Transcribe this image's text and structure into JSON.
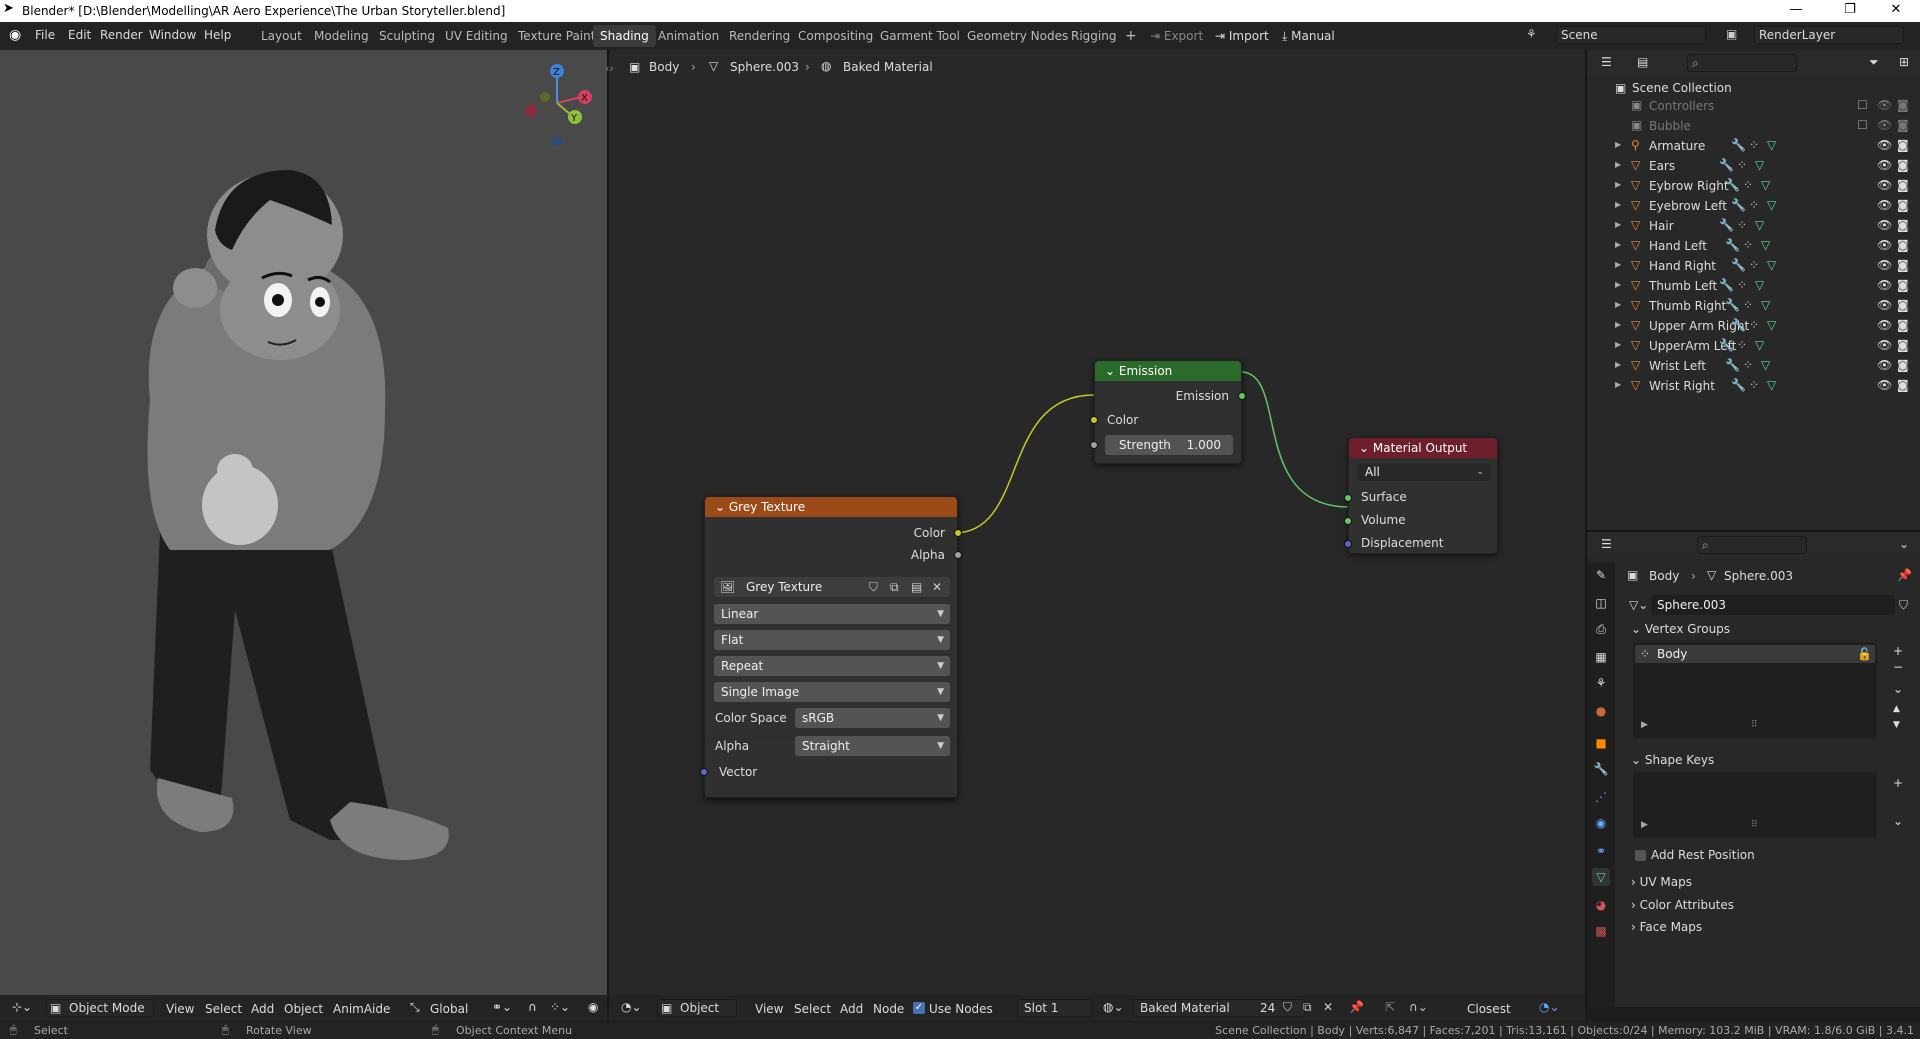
{
  "window": {
    "title": "Blender* [D:\\Blender\\Modelling\\AR Aero Experience\\The Urban Storyteller.blend]",
    "controls": [
      "—",
      "❐",
      "✕"
    ]
  },
  "menu": [
    "File",
    "Edit",
    "Render",
    "Window",
    "Help"
  ],
  "workspaces": [
    "Layout",
    "Modeling",
    "Sculpting",
    "UV Editing",
    "Texture Paint",
    "Shading",
    "Animation",
    "Rendering",
    "Compositing",
    "Garment Tool",
    "Geometry Nodes",
    "Rigging"
  ],
  "active_workspace": "Shading",
  "topbar": {
    "export": "Export",
    "import": "Import",
    "manual": "Manual",
    "scene": "Scene",
    "renderlayer": "RenderLayer"
  },
  "breadcrumb": {
    "object": "Body",
    "mesh": "Sphere.003",
    "material": "Baked Material"
  },
  "gizmo": {
    "x": "X",
    "y": "Y",
    "z": "Z"
  },
  "nodes": {
    "grey": {
      "title": "Grey Texture",
      "out_color": "Color",
      "out_alpha": "Alpha",
      "image_name": "Grey Texture",
      "interp": "Linear",
      "proj": "Flat",
      "ext": "Repeat",
      "source": "Single Image",
      "cs_label": "Color Space",
      "cs_value": "sRGB",
      "alpha_label": "Alpha",
      "alpha_value": "Straight",
      "vector": "Vector"
    },
    "emission": {
      "title": "Emission",
      "out": "Emission",
      "color": "Color",
      "strength_label": "Strength",
      "strength_value": "1.000"
    },
    "output": {
      "title": "Material Output",
      "target": "All",
      "surface": "Surface",
      "volume": "Volume",
      "displacement": "Displacement"
    }
  },
  "node_header": {
    "mode": "Object",
    "view": "View",
    "select": "Select",
    "add": "Add",
    "node": "Node",
    "use_nodes": "Use Nodes",
    "slot": "Slot 1",
    "material": "Baked Material",
    "users": "24",
    "closest": "Closest"
  },
  "viewport_header": {
    "mode": "Object Mode",
    "view": "View",
    "select": "Select",
    "add": "Add",
    "object": "Object",
    "animaide": "AnimAide",
    "orientation": "Global"
  },
  "outliner": {
    "root": "Scene Collection",
    "items": [
      {
        "name": "Controllers",
        "dim": true
      },
      {
        "name": "Bubble",
        "dim": true
      },
      {
        "name": "Armature"
      },
      {
        "name": "Ears"
      },
      {
        "name": "Eybrow Right"
      },
      {
        "name": "Eyebrow Left"
      },
      {
        "name": "Hair"
      },
      {
        "name": "Hand Left"
      },
      {
        "name": "Hand Right"
      },
      {
        "name": "Thumb Left"
      },
      {
        "name": "Thumb Right"
      },
      {
        "name": "Upper Arm Right"
      },
      {
        "name": "UpperArm Left"
      },
      {
        "name": "Wrist Left"
      },
      {
        "name": "Wrist Right"
      }
    ]
  },
  "properties": {
    "object": "Body",
    "mesh": "Sphere.003",
    "mesh_field": "Sphere.003",
    "vertex_groups": "Vertex Groups",
    "vg_item": "Body",
    "shape_keys": "Shape Keys",
    "add_rest": "Add Rest Position",
    "uv_maps": "UV Maps",
    "color_attrs": "Color Attributes",
    "face_maps": "Face Maps"
  },
  "statusbar": {
    "select": "Select",
    "rotate": "Rotate View",
    "context": "Object Context Menu",
    "stats": "Scene Collection | Body | Verts:6,847 | Faces:7,201 | Tris:13,161 | Objects:0/24 | Memory: 103.2 MiB | VRAM: 1.8/6.0 GiB | 3.4.1"
  },
  "colors": {
    "grey_head": "#9c4a17",
    "emission_head": "#2a6a2a",
    "output_head": "#6e1f2b",
    "socket_yellow": "#c7c729",
    "socket_green": "#63c763",
    "socket_blue": "#6363c7",
    "socket_grey": "#a1a1a1"
  }
}
